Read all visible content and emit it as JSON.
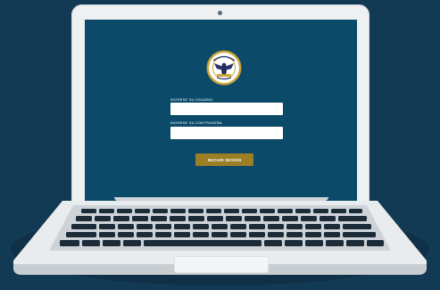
{
  "login": {
    "user_label": "INGRESE SU USUARIO",
    "user_value": "",
    "password_label": "INGRESE SU CONTRASEÑA",
    "password_value": "",
    "submit_label": "INICIAR SESIÓN"
  },
  "colors": {
    "background": "#123a55",
    "screen": "#0b4a69",
    "button": "#9c7e24",
    "laptop_body": "#e9ecee",
    "keys": "#1b2b38"
  },
  "icons": {
    "seal": "institution-seal-logo"
  }
}
